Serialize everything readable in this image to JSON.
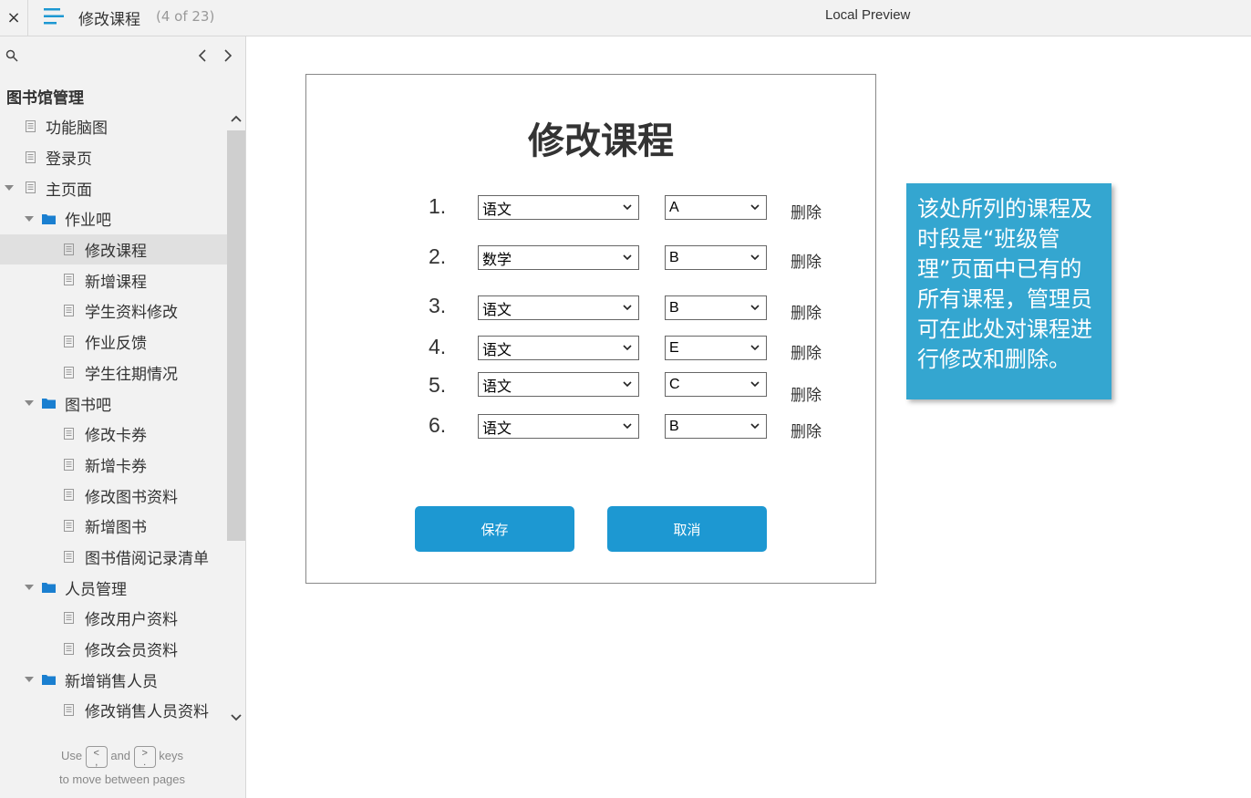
{
  "topbar": {
    "close_label": "×",
    "title": "修改课程",
    "count": "(4 of 23)",
    "preview": "Local Preview"
  },
  "sidebar": {
    "project": "图书馆管理",
    "items": [
      {
        "label": "功能脑图",
        "type": "page",
        "level": 0
      },
      {
        "label": "登录页",
        "type": "page",
        "level": 0
      },
      {
        "label": "主页面",
        "type": "page",
        "level": 0,
        "expanded": true
      },
      {
        "label": "作业吧",
        "type": "folder",
        "level": 1,
        "expanded": true
      },
      {
        "label": "修改课程",
        "type": "page",
        "level": 2,
        "selected": true
      },
      {
        "label": "新增课程",
        "type": "page",
        "level": 2
      },
      {
        "label": "学生资料修改",
        "type": "page",
        "level": 2
      },
      {
        "label": "作业反馈",
        "type": "page",
        "level": 2
      },
      {
        "label": "学生往期情况",
        "type": "page",
        "level": 2
      },
      {
        "label": "图书吧",
        "type": "folder",
        "level": 1,
        "expanded": true
      },
      {
        "label": "修改卡券",
        "type": "page",
        "level": 2
      },
      {
        "label": "新增卡券",
        "type": "page",
        "level": 2
      },
      {
        "label": "修改图书资料",
        "type": "page",
        "level": 2
      },
      {
        "label": "新增图书",
        "type": "page",
        "level": 2
      },
      {
        "label": "图书借阅记录清单",
        "type": "page",
        "level": 2
      },
      {
        "label": "人员管理",
        "type": "folder",
        "level": 1,
        "expanded": true
      },
      {
        "label": "修改用户资料",
        "type": "page",
        "level": 2
      },
      {
        "label": "修改会员资料",
        "type": "page",
        "level": 2
      },
      {
        "label": "新增销售人员",
        "type": "folder",
        "level": 1,
        "expanded": true
      },
      {
        "label": "修改销售人员资料",
        "type": "page",
        "level": 2
      }
    ],
    "hint_use": "Use",
    "hint_and": "and",
    "hint_keys": "keys",
    "hint_line2": "to move between pages",
    "key_prev": "<\n,",
    "key_next": ">\n."
  },
  "form": {
    "title": "修改课程",
    "rows": [
      {
        "num": "1.",
        "course": "语文",
        "slot": "A",
        "delete": "删除"
      },
      {
        "num": "2.",
        "course": "数学",
        "slot": "B",
        "delete": "删除"
      },
      {
        "num": "3.",
        "course": "语文",
        "slot": "B",
        "delete": "删除"
      },
      {
        "num": "4.",
        "course": "语文",
        "slot": "E",
        "delete": "删除"
      },
      {
        "num": "5.",
        "course": "语文",
        "slot": "C",
        "delete": "删除"
      },
      {
        "num": "6.",
        "course": "语文",
        "slot": "B",
        "delete": "删除"
      }
    ],
    "save_label": "保存",
    "cancel_label": "取消"
  },
  "note": {
    "text": "该处所列的课程及时段是“班级管理”页面中已有的所有课程，管理员可在此处对课程进行修改和删除。"
  },
  "colors": {
    "accent": "#1d98d2",
    "note": "#34a6d0",
    "folder": "#1a7fd0"
  }
}
